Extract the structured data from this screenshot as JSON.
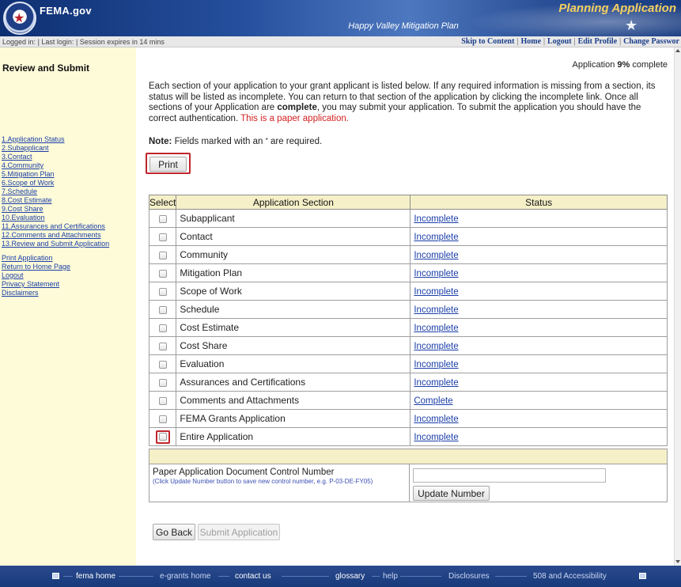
{
  "header": {
    "site_name": "FEMA.gov",
    "app_title": "Planning Application",
    "plan_name": "Happy Valley Mitigation Plan"
  },
  "statusbar": {
    "logged_in": "Logged in:",
    "last_login": "| Last login:",
    "session": "| Session expires in 14 mins",
    "links": [
      "Skip to Content",
      "Home",
      "Logout",
      "Edit Profile",
      "Change Passwor"
    ],
    "separator": "|"
  },
  "sidebar": {
    "title": "Review and Submit",
    "steps": [
      "1.Application Status",
      "2.Subapplicant",
      "3.Contact",
      "4.Community",
      "5.Mitigation Plan",
      "6.Scope of Work",
      "7.Schedule",
      "8.Cost Estimate",
      "9.Cost Share",
      "10.Evaluation",
      "11.Assurances and Certifications",
      "12.Comments and Attachments",
      "13.Review and Submit Application"
    ],
    "links": [
      "Print Application",
      "Return to Home Page",
      "Logout",
      "Privacy Statement",
      "Disclaimers"
    ]
  },
  "main": {
    "progress_prefix": "Application",
    "progress_value": "9%",
    "progress_suffix": "complete",
    "intro_part1": "Each section of your application to your grant applicant is listed below. If any required information is missing from a section, its status will be listed as incomplete. You can return to that section of the application by clicking the incomplete link. Once all sections of your Application are",
    "intro_bold": "complete",
    "intro_part2": ", you may submit your application. To submit the application you should have the correct authentication.",
    "intro_red": "This is a paper application.",
    "note_label": "Note:",
    "note_text": "Fields marked with an",
    "note_asterisk": "*",
    "note_suffix": "are required.",
    "print_label": "Print",
    "table_headers": {
      "select": "Select",
      "section": "Application Section",
      "status": "Status"
    },
    "sections": [
      {
        "name": "Subapplicant",
        "status": "Incomplete"
      },
      {
        "name": "Contact",
        "status": "Incomplete"
      },
      {
        "name": "Community",
        "status": "Incomplete"
      },
      {
        "name": "Mitigation Plan",
        "status": "Incomplete"
      },
      {
        "name": "Scope of Work",
        "status": "Incomplete"
      },
      {
        "name": "Schedule",
        "status": "Incomplete"
      },
      {
        "name": "Cost Estimate",
        "status": "Incomplete"
      },
      {
        "name": "Cost Share",
        "status": "Incomplete"
      },
      {
        "name": "Evaluation",
        "status": "Incomplete"
      },
      {
        "name": "Assurances and Certifications",
        "status": "Incomplete"
      },
      {
        "name": "Comments and Attachments",
        "status": "Complete"
      },
      {
        "name": "FEMA Grants Application",
        "status": "Incomplete"
      },
      {
        "name": "Entire Application",
        "status": "Incomplete"
      }
    ],
    "control_label": "Paper Application Document Control Number",
    "control_hint": "(Click Update Number button to save new control number, e.g. P-03-DE-FY05)",
    "control_value": "",
    "update_label": "Update Number",
    "go_back_label": "Go Back",
    "submit_label": "Submit Application"
  },
  "footer": {
    "links": [
      "fema home",
      "e-grants home",
      "contact us",
      "glossary",
      "help",
      "Disclosures",
      "508 and Accessibility"
    ]
  },
  "colors": {
    "banner": "#254f9c",
    "sidebar_bg": "#fdfbd8",
    "table_header_bg": "#f6f0c8",
    "link": "#1b3ea8",
    "highlight_border": "#c0262c",
    "paper_warning": "#d42020",
    "app_title": "#f6d060"
  }
}
